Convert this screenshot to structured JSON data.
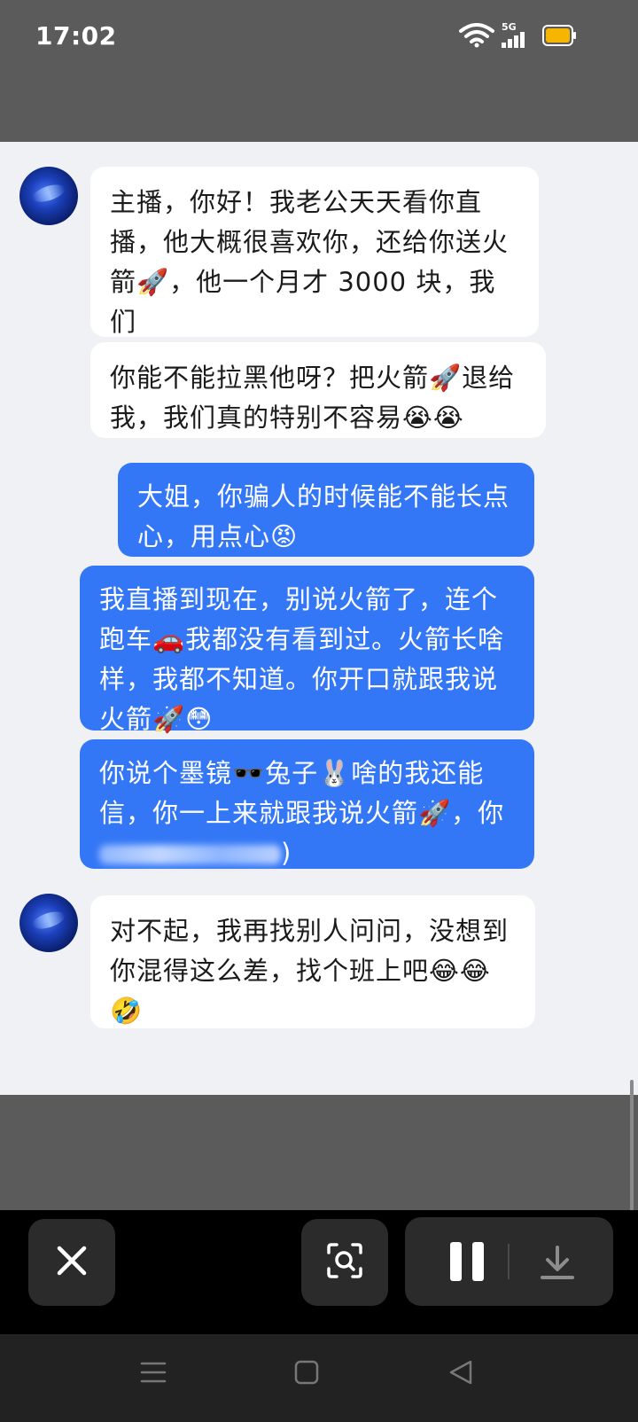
{
  "status_bar": {
    "time": "17:02",
    "network": "5G",
    "icons": [
      "wifi-icon",
      "signal-icon",
      "battery-icon"
    ],
    "battery_color": "#f6b500"
  },
  "chat": {
    "messages": [
      {
        "side": "left",
        "text": "主播，你好！我老公天天看你直\n播，他大概很喜欢你，还给你送火\n箭🚀，他一个月才 3000 块，我们\n还有三个孩子要养😭😭😭"
      },
      {
        "side": "left",
        "text": "你能不能拉黑他呀？把火箭🚀退给\n我，我们真的特别不容易😭😭"
      },
      {
        "side": "right",
        "text": "大姐，你骗人的时候能不能长点\n心，用点心😡"
      },
      {
        "side": "right",
        "text": "我直播到现在，别说火箭了，连个\n跑车🚗我都没有看到过。火箭长啥\n样，我都不知道。你开口就跟我说\n火箭🚀😳"
      },
      {
        "side": "right",
        "text": "你说个墨镜🕶️兔子🐰啥的我还能\n信，你一上来就跟我说火箭🚀，你\n",
        "text_end": ")"
      },
      {
        "side": "left",
        "text": "对不起，我再找别人问问，没想到\n你混得这么差，找个班上吧😂😂\n🤣"
      }
    ],
    "colors": {
      "incoming_bubble": "#ffffff",
      "outgoing_bubble": "#3377f6",
      "background": "#f0f1f5"
    }
  },
  "player_controls": {
    "icons": [
      "close-icon",
      "screenshot-search-icon",
      "pause-icon",
      "download-icon"
    ]
  },
  "nav_bar": {
    "icons": [
      "menu-icon",
      "home-icon",
      "back-icon"
    ]
  }
}
